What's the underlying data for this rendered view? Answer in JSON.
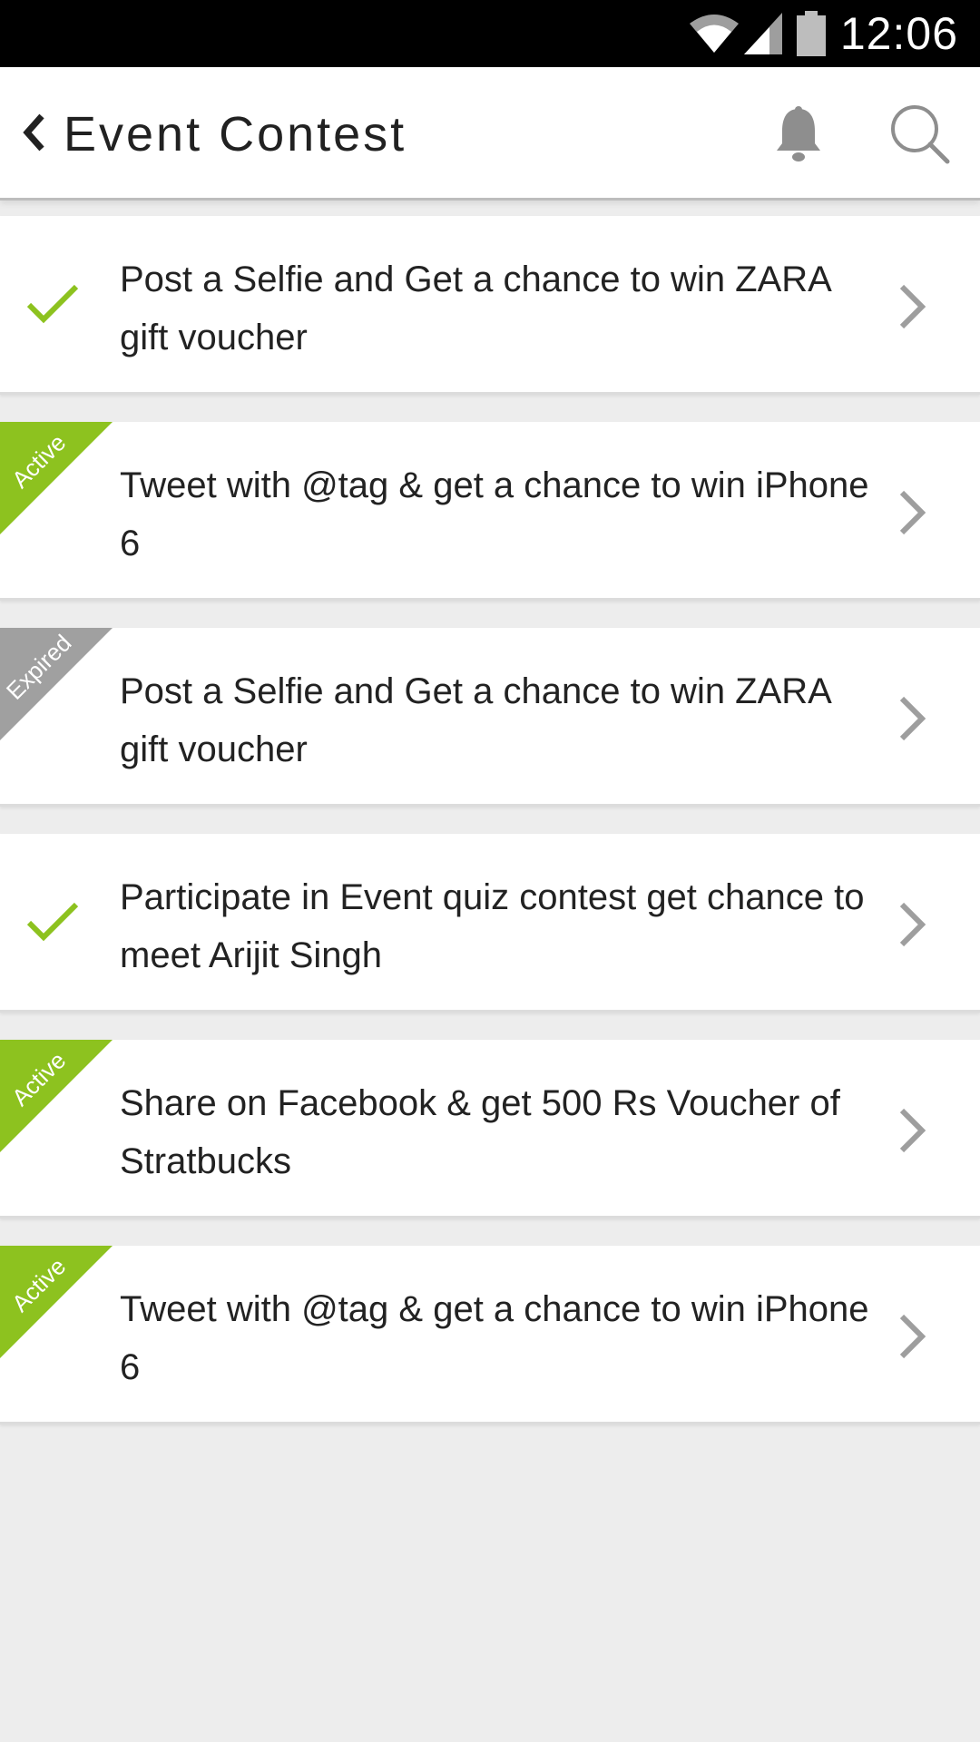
{
  "status_bar": {
    "time": "12:06",
    "icons": [
      "wifi-icon",
      "signal-icon",
      "battery-icon"
    ]
  },
  "app_bar": {
    "back_icon": "back-chevron-icon",
    "title": "Event Contest",
    "actions": [
      "bell-icon",
      "search-icon"
    ]
  },
  "contests": [
    {
      "title": "Post a Selfie and Get a chance to win ZARA gift voucher",
      "status": "completed",
      "badge": ""
    },
    {
      "title": "Tweet with @tag & get a chance to win iPhone 6",
      "status": "active",
      "badge": "Active"
    },
    {
      "title": "Post a Selfie and Get a chance to win ZARA gift voucher",
      "status": "expired",
      "badge": "Expired"
    },
    {
      "title": "Participate in Event quiz contest get chance to meet Arijit Singh",
      "status": "completed",
      "badge": ""
    },
    {
      "title": "Share on Facebook & get 500 Rs Voucher of Stratbucks",
      "status": "active",
      "badge": "Active"
    },
    {
      "title": "Tweet with @tag & get a chance to win iPhone 6",
      "status": "active",
      "badge": "Active"
    }
  ],
  "colors": {
    "accent_green": "#8dc21f",
    "expired_gray": "#a0a0a0",
    "background": "#ededed"
  }
}
